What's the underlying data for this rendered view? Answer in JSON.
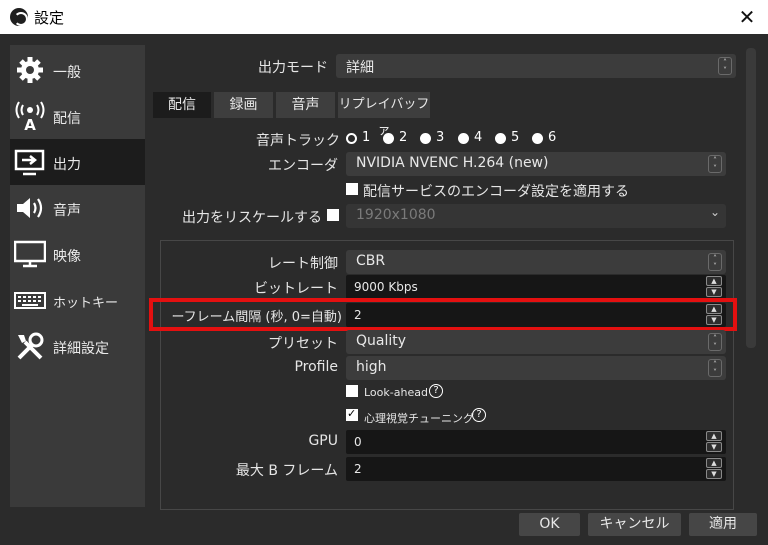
{
  "window": {
    "title": "設定"
  },
  "sidebar": {
    "items": [
      {
        "label": "一般"
      },
      {
        "label": "配信"
      },
      {
        "label": "出力"
      },
      {
        "label": "音声"
      },
      {
        "label": "映像"
      },
      {
        "label": "ホットキー"
      },
      {
        "label": "詳細設定"
      }
    ],
    "active_index": 2
  },
  "output_mode": {
    "label": "出力モード",
    "value": "詳細"
  },
  "tabs": [
    {
      "label": "配信"
    },
    {
      "label": "録画"
    },
    {
      "label": "音声"
    },
    {
      "label": "リプレイバッファ"
    }
  ],
  "audio_track": {
    "label": "音声トラック",
    "options": [
      "1",
      "2",
      "3",
      "4",
      "5",
      "6"
    ],
    "selected": "1"
  },
  "encoder": {
    "label": "エンコーダ",
    "value": "NVIDIA NVENC H.264 (new)"
  },
  "apply_service_settings": {
    "label": "配信サービスのエンコーダ設定を適用する",
    "checked": false
  },
  "rescale": {
    "label": "出力をリスケールする",
    "value": "1920x1080",
    "checked": false
  },
  "rate_control": {
    "label": "レート制御",
    "value": "CBR"
  },
  "bitrate": {
    "label": "ビットレート",
    "value": "9000 Kbps"
  },
  "keyframe_interval": {
    "label": "ーフレーム間隔 (秒, 0=自動)",
    "value": "2"
  },
  "preset": {
    "label": "プリセット",
    "value": "Quality"
  },
  "profile": {
    "label": "Profile",
    "value": "high"
  },
  "lookahead": {
    "label": "Look-ahead",
    "checked": false
  },
  "psycho_visual": {
    "label": "心理視覚チューニング",
    "checked": true
  },
  "gpu": {
    "label": "GPU",
    "value": "0"
  },
  "max_bframes": {
    "label": "最大 B フレーム",
    "value": "2"
  },
  "buttons": {
    "ok": "OK",
    "cancel": "キャンセル",
    "apply": "適用"
  },
  "colors": {
    "highlight": "#e41010",
    "background": "#2b2b2b",
    "sidebar": "#3a3a3a"
  }
}
